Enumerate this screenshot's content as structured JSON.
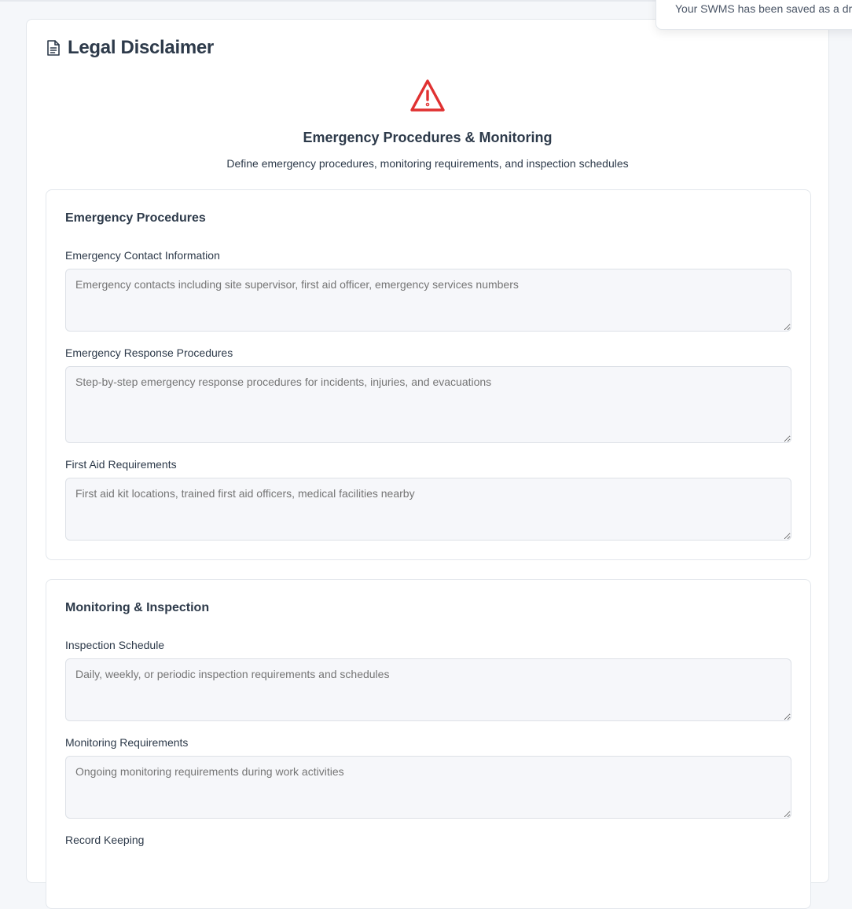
{
  "toast": {
    "message": "Your SWMS has been saved as a dr"
  },
  "card": {
    "title": "Legal Disclaimer",
    "icon": "document-icon"
  },
  "hero": {
    "icon": "warning-triangle-icon",
    "title": "Emergency Procedures & Monitoring",
    "subtitle": "Define emergency procedures, monitoring requirements, and inspection schedules"
  },
  "emergency": {
    "title": "Emergency Procedures",
    "fields": [
      {
        "label": "Emergency Contact Information",
        "placeholder": "Emergency contacts including site supervisor, first aid officer, emergency services numbers",
        "value": ""
      },
      {
        "label": "Emergency Response Procedures",
        "placeholder": "Step-by-step emergency response procedures for incidents, injuries, and evacuations",
        "value": ""
      },
      {
        "label": "First Aid Requirements",
        "placeholder": "First aid kit locations, trained first aid officers, medical facilities nearby",
        "value": ""
      }
    ]
  },
  "monitoring": {
    "title": "Monitoring & Inspection",
    "fields": [
      {
        "label": "Inspection Schedule",
        "placeholder": "Daily, weekly, or periodic inspection requirements and schedules",
        "value": ""
      },
      {
        "label": "Monitoring Requirements",
        "placeholder": "Ongoing monitoring requirements during work activities",
        "value": ""
      },
      {
        "label": "Record Keeping"
      }
    ]
  },
  "colors": {
    "warning": "#e03131",
    "text": "#2d3a4a",
    "field_bg": "#f6f7fa"
  }
}
